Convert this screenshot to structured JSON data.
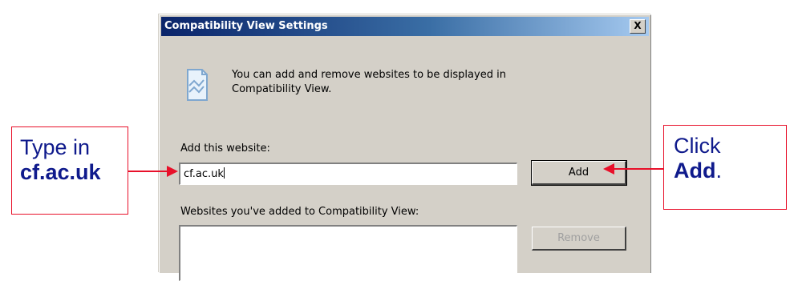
{
  "dialog": {
    "title": "Compatibility View Settings",
    "close_label": "X",
    "info_text": "You can add and remove websites to be displayed in Compatibility View.",
    "add_label": "Add this website:",
    "website_value": "cf.ac.uk",
    "add_button": "Add",
    "added_label": "Websites you've added to Compatibility View:",
    "remove_button": "Remove"
  },
  "annotations": {
    "left_line1": "Type in",
    "left_line2": "cf.ac.uk",
    "right_line1": "Click",
    "right_bold": "Add",
    "right_suffix": ".",
    "color": "#e8102a",
    "text_color": "#0f1a8c"
  }
}
